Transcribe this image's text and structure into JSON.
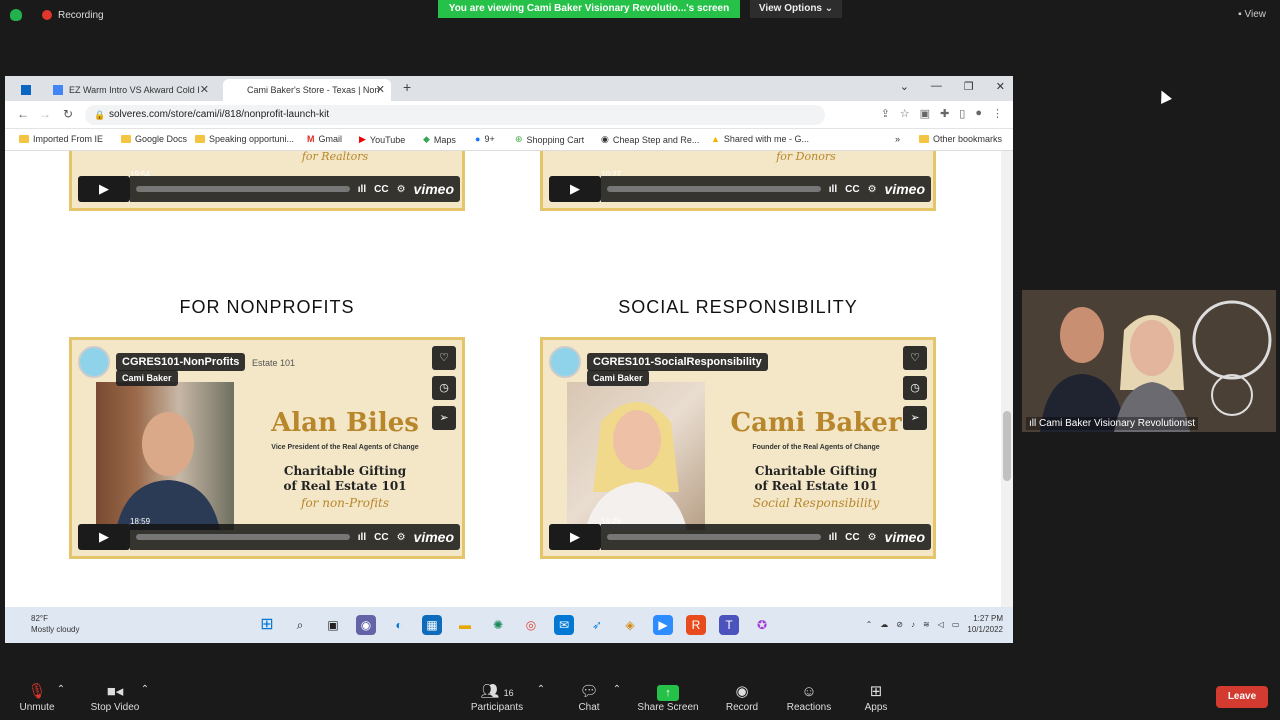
{
  "zoom": {
    "recording_label": "Recording",
    "share_banner": "You are viewing Cami Baker Visionary Revolutio...'s screen",
    "view_options": "View Options",
    "view_button": "View",
    "participant_name": "Cami Baker Visionary Revolutionist",
    "participant_count": "16",
    "toolbar": {
      "unmute": "Unmute",
      "stop_video": "Stop Video",
      "participants": "Participants",
      "chat": "Chat",
      "share_screen": "Share Screen",
      "record": "Record",
      "reactions": "Reactions",
      "apps": "Apps",
      "leave": "Leave"
    }
  },
  "browser": {
    "tabs": [
      {
        "label": "EZ Warm Intro VS Akward Cold I"
      },
      {
        "label": "Cami Baker's Store - Texas | Non"
      }
    ],
    "url": "solveres.com/store/cami/i/818/nonprofit-launch-kit",
    "bookmarks": [
      "Imported From IE",
      "Google Docs",
      "Speaking opportuni...",
      "Gmail",
      "YouTube",
      "Maps",
      "9+",
      "Shopping Cart",
      "Cheap Step and Re...",
      "Shared with me - G...",
      "Other bookmarks"
    ]
  },
  "page": {
    "top_videos": [
      {
        "time": "19:54",
        "script": "for Realtors"
      },
      {
        "time": "10:27",
        "script": "for Donors"
      }
    ],
    "sections": [
      {
        "title": "FOR NONPROFITS",
        "video_title": "CGRES101-NonProfits",
        "author": "Cami Baker",
        "name": "Alan Biles",
        "subline": "Vice President of the Real Agents of Change",
        "course_line1": "Charitable Gifting",
        "course_line2": "of Real Estate 101",
        "script": "for non-Profits",
        "time": "18:59",
        "overlay_sub": "Estate 101"
      },
      {
        "title": "SOCIAL RESPONSIBILITY",
        "video_title": "CGRES101-SocialResponsibility",
        "author": "Cami Baker",
        "name": "Cami Baker",
        "subline": "Founder of the Real Agents of Change",
        "course_line1": "Charitable Gifting",
        "course_line2": "of Real Estate 101",
        "script": "Social Responsibility",
        "time": "19:26",
        "overlay_sub": ""
      }
    ],
    "vimeo_label": "vimeo",
    "cc_label": "CC"
  },
  "taskbar": {
    "temperature": "82°F",
    "weather": "Mostly cloudy",
    "time": "1:27 PM",
    "date": "10/1/2022"
  }
}
